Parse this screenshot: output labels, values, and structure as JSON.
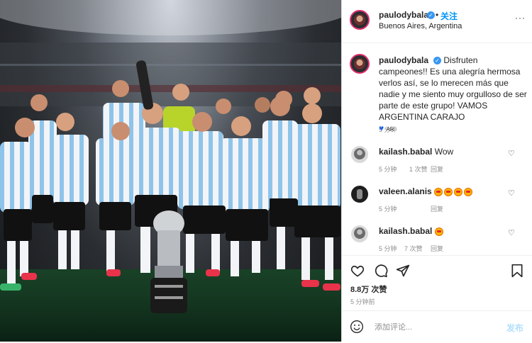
{
  "post": {
    "username": "paulodybala",
    "follow_label": "关注",
    "separator": "•",
    "location": "Buenos Aires, Argentina",
    "more_icon": "more-dots-icon"
  },
  "caption": {
    "username": "paulodybala",
    "text": "Disfruten campeones!! Es una alegría hermosa verlos así, se lo merecen más que nadie y me siento muy orgulloso de ser parte de este grupo! VAMOS ARGENTINA CARAJO",
    "flag_text": "AR",
    "time": "5 分钟"
  },
  "comments": [
    {
      "username": "kailash.babal",
      "text": "Wow",
      "time": "5 分钟",
      "likes": "1 次赞",
      "reply": "回复"
    },
    {
      "username": "valeen.alanis",
      "text": "",
      "time": "5 分钟",
      "likes": "",
      "reply": "回复"
    },
    {
      "username": "kailash.babal",
      "text": "",
      "time": "5 分钟",
      "likes": "7 次赞",
      "reply": "回复"
    }
  ],
  "actions": {
    "likes": "8.8万 次赞",
    "post_time": "5 分钟前"
  },
  "add_comment": {
    "placeholder": "添加评论...",
    "post_label": "发布"
  },
  "colors": {
    "link_blue": "#0095f6",
    "post_disabled": "#b2dffc",
    "muted": "#8e8e8e",
    "border": "#dbdbdb",
    "story_ring": "#e1306c"
  }
}
